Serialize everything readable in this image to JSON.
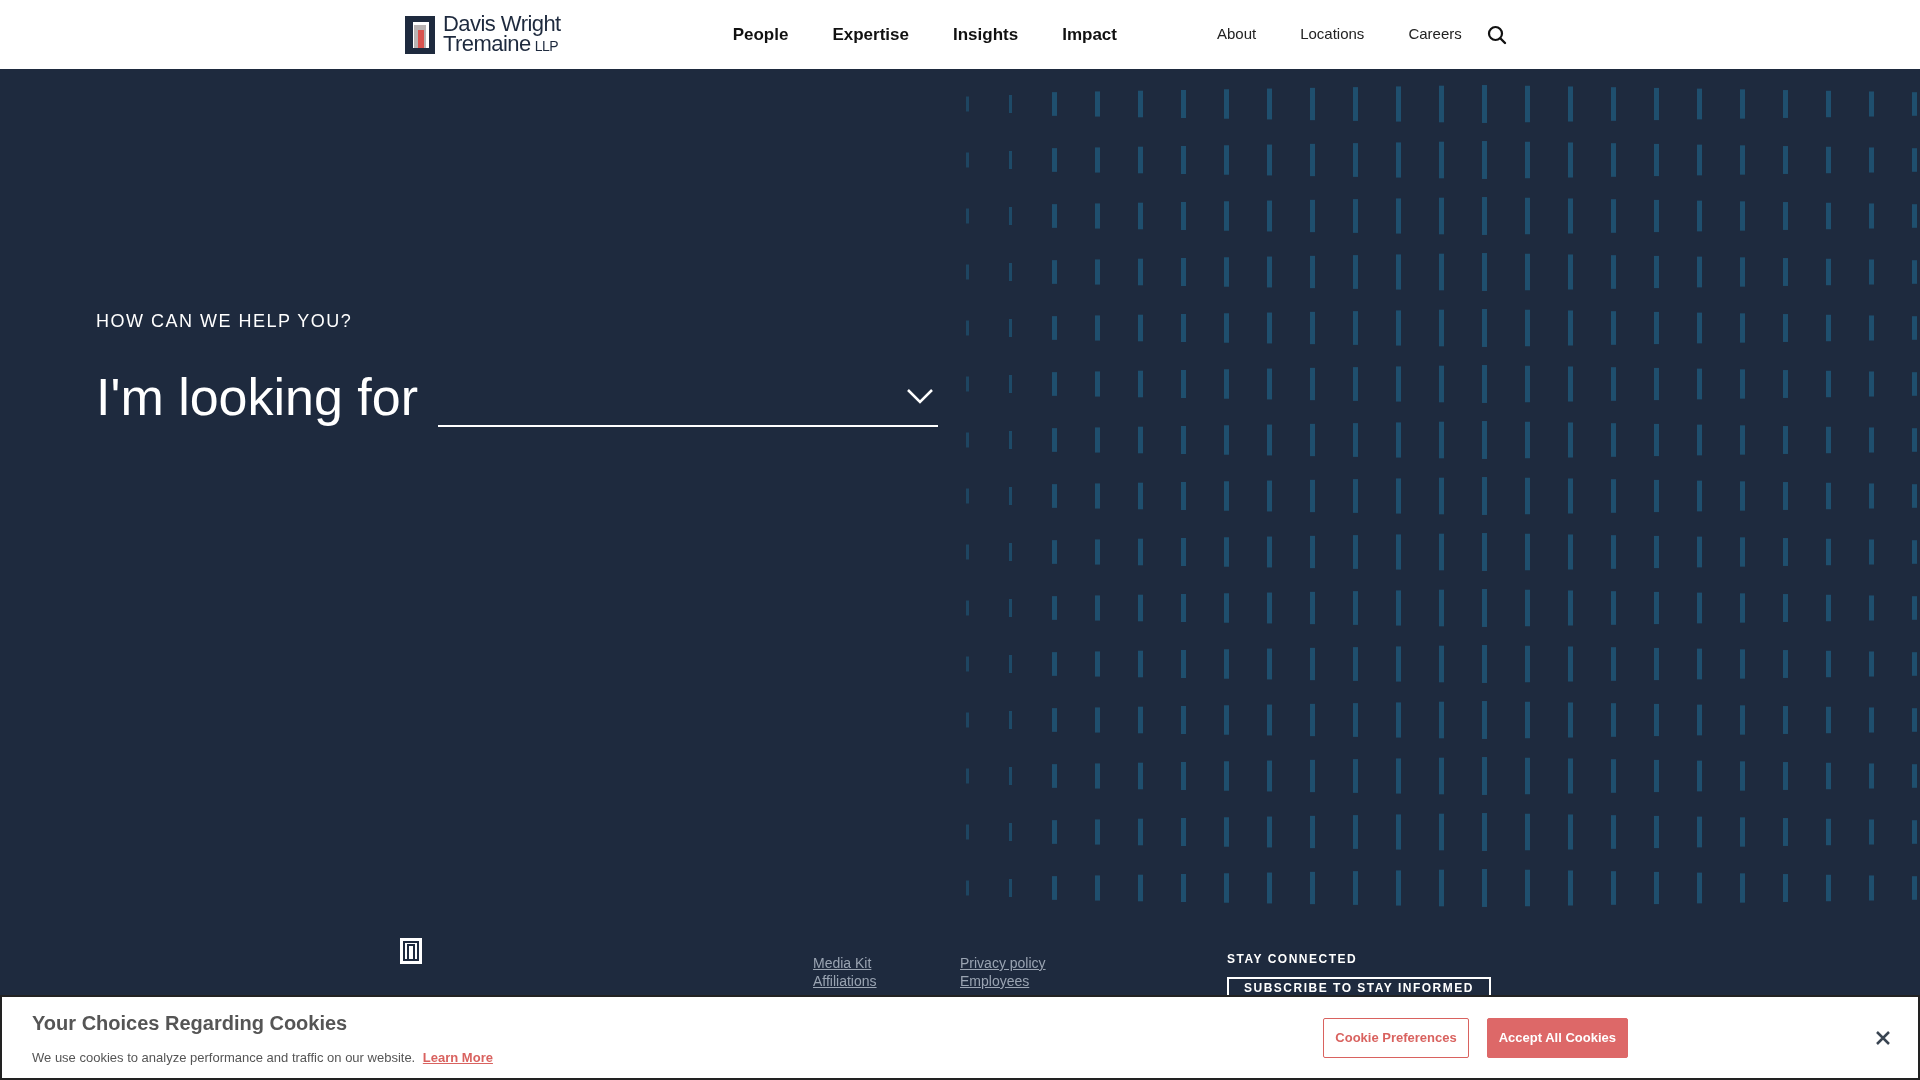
{
  "header": {
    "logo": {
      "line_1": "Davis Wright",
      "line_2": "Tremaine",
      "suffix": "LLP"
    },
    "primary_nav": [
      "People",
      "Expertise",
      "Insights",
      "Impact"
    ],
    "secondary_nav": [
      "About",
      "Locations",
      "Careers"
    ]
  },
  "hero": {
    "eyebrow": "HOW CAN WE HELP YOU?",
    "prompt": "I'm looking for"
  },
  "footer": {
    "links_1": [
      "Media Kit",
      "Affiliations"
    ],
    "links_2": [
      "Privacy policy",
      "Employees"
    ],
    "stay_connected": "STAY CONNECTED",
    "subscribe_button": "SUBSCRIBE TO STAY INFORMED"
  },
  "cookie_banner": {
    "title": "Your Choices Regarding Cookies",
    "text": "We use cookies to analyze performance and traffic on our website.",
    "link": "Learn More",
    "buttons": [
      {
        "label": "Cookie Preferences",
        "kind": "outline"
      },
      {
        "label": "Accept All Cookies",
        "kind": "filled"
      }
    ]
  }
}
